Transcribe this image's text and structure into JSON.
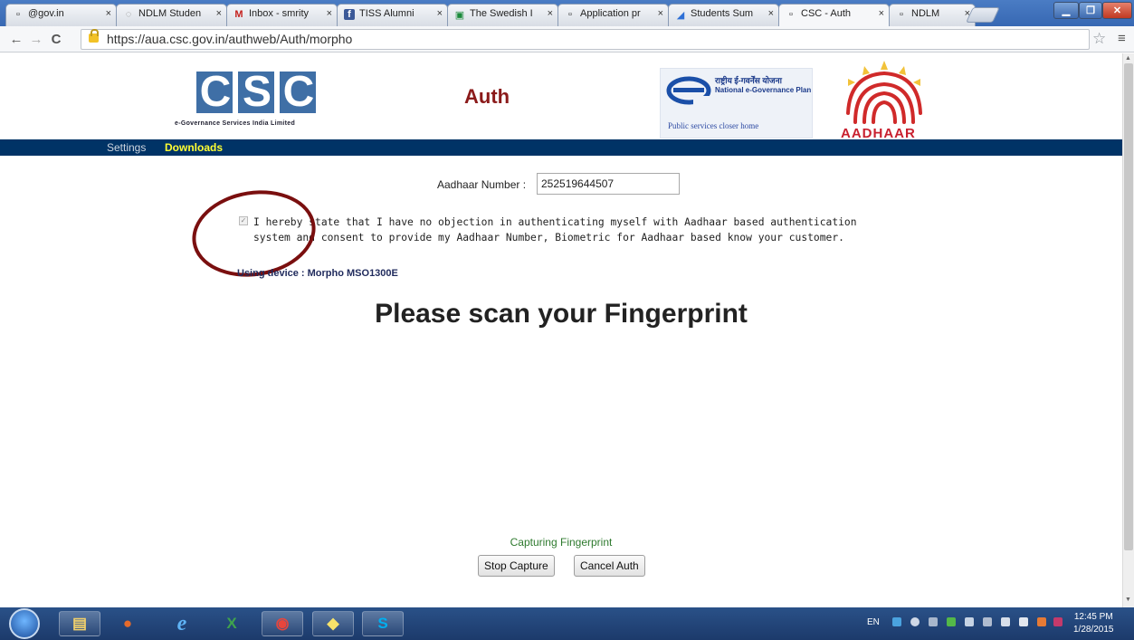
{
  "browser": {
    "tabs": [
      {
        "title": "@gov.in",
        "icon": "page-icon"
      },
      {
        "title": "NDLM Studen",
        "icon": "spinner-icon"
      },
      {
        "title": "Inbox - smrity",
        "icon": "gmail-icon"
      },
      {
        "title": "TISS Alumni",
        "icon": "facebook-icon"
      },
      {
        "title": "The Swedish I",
        "icon": "doc-icon"
      },
      {
        "title": "Application pr",
        "icon": "page-icon"
      },
      {
        "title": "Students Sum",
        "icon": "drive-icon"
      },
      {
        "title": "CSC - Auth",
        "icon": "page-icon"
      },
      {
        "title": "NDLM",
        "icon": "page-icon"
      }
    ],
    "close_glyph": "×",
    "url": "https://aua.csc.gov.in/authweb/Auth/morpho",
    "window_buttons": [
      "minimize",
      "maximize",
      "close"
    ]
  },
  "header": {
    "csc_letters": [
      "C",
      "S",
      "C"
    ],
    "csc_subtitle": "e-Governance Services India Limited",
    "title": "Auth",
    "egov_hindi": "राष्ट्रीय ई-गवर्नेंस योजना",
    "egov_english": "National e-Governance Plan",
    "egov_tagline": "Public services closer home",
    "aadhaar_text": "AADHAAR"
  },
  "nav": {
    "settings": "Settings",
    "downloads": "Downloads",
    "bar_color": "#003366",
    "settings_color": "#cfd6e0",
    "downloads_color": "#ffff33"
  },
  "form": {
    "aadhaar_label": "Aadhaar Number :",
    "aadhaar_value": "252519644507",
    "consent_checked": true,
    "consent_text": "I hereby state that I have no objection in authenticating myself with Aadhaar based authentication system and consent to provide my Aadhaar Number, Biometric for Aadhaar based know your customer.",
    "device": "Using device : Morpho MSO1300E",
    "scan_title": "Please scan your Fingerprint",
    "status": "Capturing Fingerprint",
    "stop_button": "Stop Capture",
    "cancel_button": "Cancel Auth"
  },
  "taskbar": {
    "apps": [
      {
        "name": "file-explorer",
        "glyph": "▤"
      },
      {
        "name": "media-center",
        "glyph": "●"
      },
      {
        "name": "internet-explorer",
        "glyph": "e"
      },
      {
        "name": "excel",
        "glyph": "X"
      },
      {
        "name": "chrome",
        "glyph": "◉"
      },
      {
        "name": "sticky-notes",
        "glyph": "◆"
      },
      {
        "name": "skype",
        "glyph": "S"
      }
    ],
    "language": "EN",
    "time": "12:45 PM",
    "date": "1/28/2015"
  }
}
